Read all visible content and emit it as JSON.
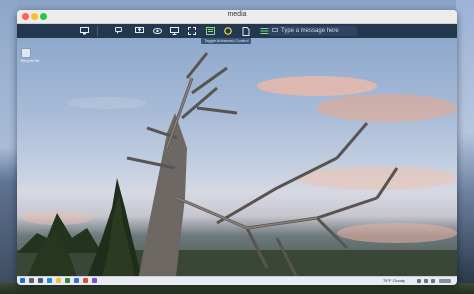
{
  "window": {
    "title": "media"
  },
  "toolbar": {
    "message_placeholder": "Type a message here",
    "tooltip": "Toggle Advanced Control"
  },
  "remote_desktop": {
    "desktop_icons": [
      {
        "label": "Recycle Bin"
      }
    ],
    "taskbar": {
      "weather": "78°F Cloudy",
      "colors": {
        "start": "#1c6fd3",
        "edge": "#1a8cd8",
        "explorer": "#f3c13a"
      }
    }
  },
  "colors": {
    "toolbar_bg": "#23374f",
    "titlebar_bg": "#ececec"
  }
}
